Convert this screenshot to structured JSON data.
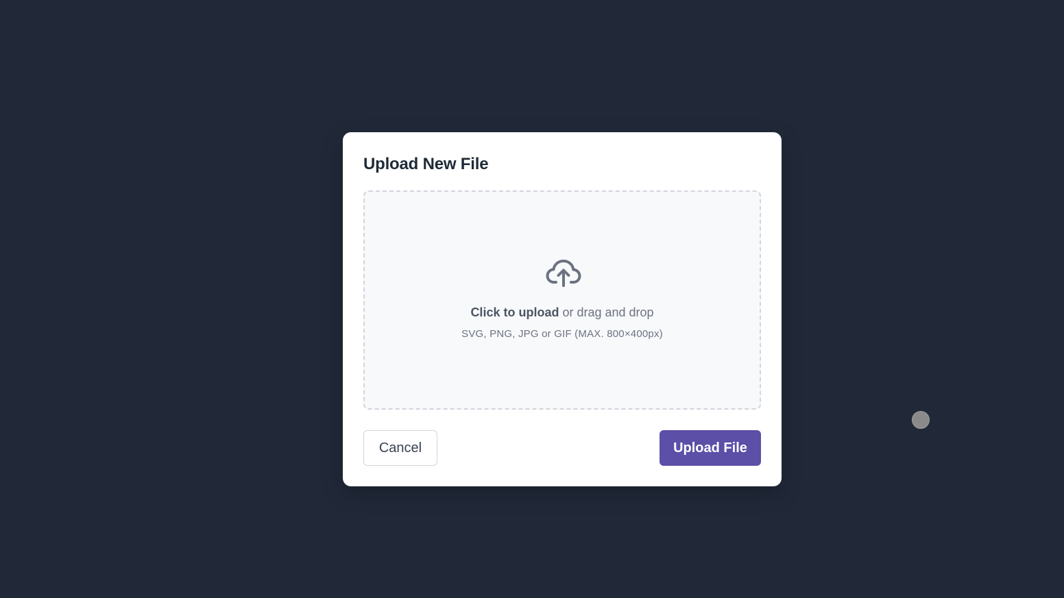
{
  "dialog": {
    "title": "Upload New File",
    "dropzone": {
      "icon": "cloud-upload-icon",
      "click_text": "Click to upload",
      "drag_text": " or drag and drop",
      "hint": "SVG, PNG, JPG or GIF (MAX. 800×400px)"
    },
    "buttons": {
      "cancel_label": "Cancel",
      "upload_label": "Upload File"
    }
  },
  "colors": {
    "backdrop": "#212939",
    "primary": "#5b4fa8",
    "dropzone_bg": "#f8f9fb",
    "dropzone_border": "#d1d5db"
  }
}
